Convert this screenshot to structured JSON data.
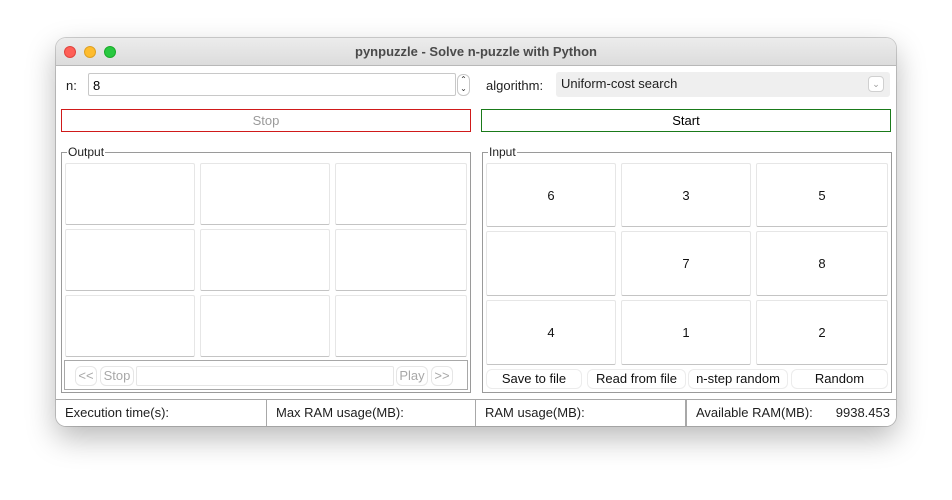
{
  "window": {
    "title": "pynpuzzle - Solve n-puzzle with Python"
  },
  "controls": {
    "n_label": "n:",
    "n_value": "8",
    "algorithm_label": "algorithm:",
    "algorithm_value": "Uniform-cost search",
    "stop_label": "Stop",
    "start_label": "Start",
    "stop_border_color": "#d01a1a",
    "start_border_color": "#1a7a1a"
  },
  "output": {
    "title": "Output",
    "cells": [
      "",
      "",
      "",
      "",
      "",
      "",
      "",
      "",
      ""
    ],
    "player": {
      "prev_label": "<<",
      "stop_label": "Stop",
      "play_label": "Play",
      "next_label": ">>"
    }
  },
  "input": {
    "title": "Input",
    "cells": [
      "6",
      "3",
      "5",
      "",
      "7",
      "8",
      "4",
      "1",
      "2"
    ],
    "actions": [
      "Save to file",
      "Read from file",
      "n-step random",
      "Random"
    ]
  },
  "status": {
    "execution_time_label": "Execution time(s):",
    "execution_time_value": "",
    "max_ram_label": "Max RAM usage(MB):",
    "max_ram_value": "",
    "ram_label": "RAM usage(MB):",
    "ram_value": "",
    "available_ram_label": "Available RAM(MB):",
    "available_ram_value": "9938.453"
  }
}
